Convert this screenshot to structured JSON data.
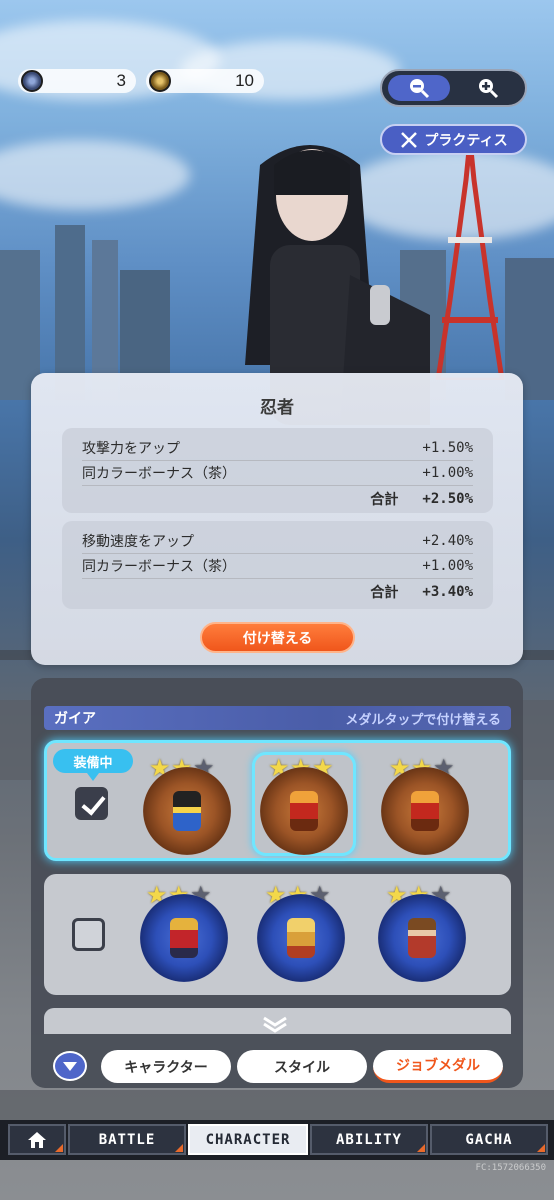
{
  "currency": [
    {
      "icon": "gem-coin-icon",
      "value": "3"
    },
    {
      "icon": "gold-coin-icon",
      "value": "10"
    }
  ],
  "zoom": {
    "out_icon": "zoom-out-icon",
    "in_icon": "zoom-in-icon"
  },
  "practice": {
    "label": "プラクティス",
    "icon": "crossed-swords-icon"
  },
  "popup": {
    "title": "忍者",
    "groups": [
      {
        "rows": [
          {
            "label": "攻撃力をアップ",
            "value": "+1.50%"
          },
          {
            "label": "同カラーボーナス（茶）",
            "value": "+1.00%"
          }
        ],
        "total_label": "合計",
        "total": "+2.50%"
      },
      {
        "rows": [
          {
            "label": "移動速度をアップ",
            "value": "+2.40%"
          },
          {
            "label": "同カラーボーナス（茶）",
            "value": "+1.00%"
          }
        ],
        "total_label": "合計",
        "total": "+3.40%"
      }
    ],
    "button": "付け替える"
  },
  "medal_panel": {
    "title": "ガイア",
    "hint": "メダルタップで付け替える",
    "equipped_label": "装備中",
    "sets": [
      {
        "equipped": true,
        "medals": [
          {
            "color": "brown",
            "stars": 2,
            "name": "black-mage-medal-icon"
          },
          {
            "color": "brown",
            "stars": 3,
            "name": "red-warrior-medal-icon",
            "selected": true
          },
          {
            "color": "brown",
            "stars": 2,
            "name": "red-warrior-medal-icon"
          }
        ]
      },
      {
        "equipped": false,
        "medals": [
          {
            "color": "blue",
            "stars": 2,
            "name": "red-mage-medal-icon"
          },
          {
            "color": "blue",
            "stars": 2,
            "name": "blonde-hero-medal-icon"
          },
          {
            "color": "blue",
            "stars": 2,
            "name": "brown-hair-hero-medal-icon"
          }
        ]
      }
    ],
    "more_icon": "double-chevron-down-icon"
  },
  "tabs": [
    {
      "label": "キャラクター",
      "active": false
    },
    {
      "label": "スタイル",
      "active": false
    },
    {
      "label": "ジョブメダル",
      "active": true
    }
  ],
  "nav": [
    {
      "label": "",
      "icon": "home-icon"
    },
    {
      "label": "BATTLE"
    },
    {
      "label": "CHARACTER",
      "active": true
    },
    {
      "label": "ABILITY"
    },
    {
      "label": "GACHA"
    }
  ],
  "footer_code": "FC:1572066350",
  "colors": {
    "accent_blue": "#4f66c9",
    "accent_orange": "#f0561b",
    "select_cyan": "#6fe6ff"
  }
}
